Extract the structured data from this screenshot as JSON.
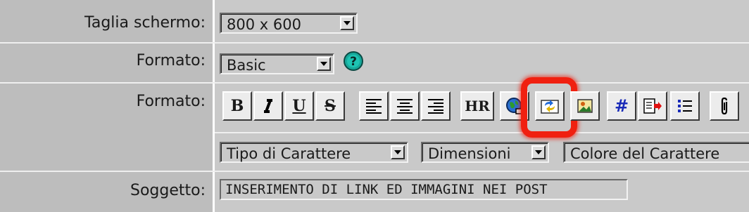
{
  "rows": {
    "screen_size": {
      "label": "Taglia schermo:",
      "value": "800 x 600"
    },
    "format_select": {
      "label": "Formato:",
      "value": "Basic"
    },
    "format_toolbar": {
      "label": "Formato:"
    },
    "subject": {
      "label": "Soggetto:",
      "value": "INSERIMENTO DI LINK ED IMMAGINI NEI POST"
    }
  },
  "toolbar": {
    "bold": "B",
    "italic": "I",
    "underline": "U",
    "strike": "S",
    "hr": "HR",
    "buttons": [
      "bold",
      "italic",
      "underline",
      "strikethrough",
      "align-left",
      "align-center",
      "align-right",
      "horizontal-rule",
      "insert-link",
      "insert-hyperlink",
      "insert-image",
      "insert-code",
      "insert-quote",
      "insert-list",
      "attach-file"
    ],
    "highlighted": "insert-hyperlink"
  },
  "font_controls": {
    "font_family": "Tipo di Carattere",
    "font_size": "Dimensioni",
    "font_color": "Colore del Carattere"
  },
  "colors": {
    "highlight": "#f02010",
    "help_icon": "#17a89a"
  }
}
